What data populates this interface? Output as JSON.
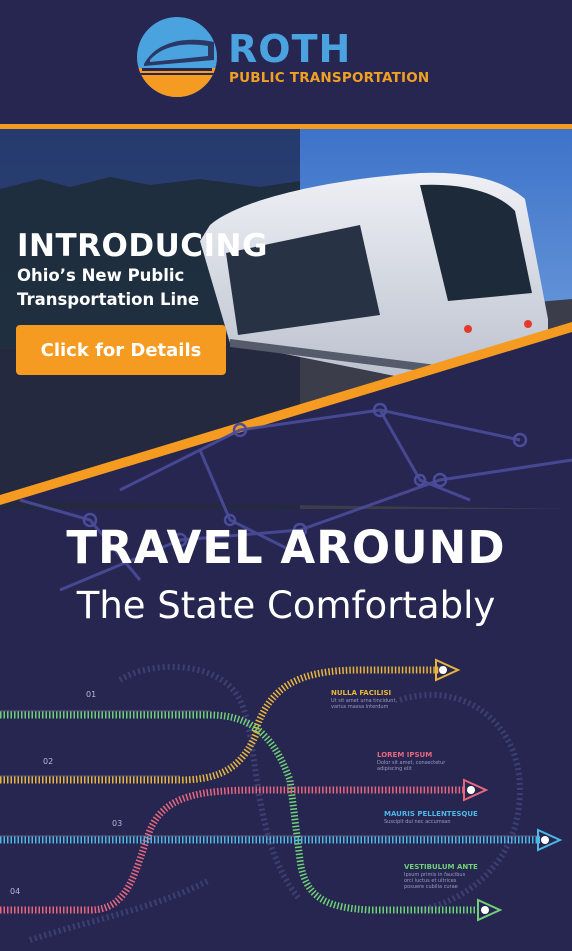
{
  "brand": {
    "name": "ROTH",
    "tagline": "PUBLIC TRANSPORTATION"
  },
  "hero": {
    "title": "INTRODUCING",
    "subtitle": "Ohio’s New Public Transportation Line",
    "cta_label": "Click for Details"
  },
  "promo": {
    "headline": "TRAVEL AROUND",
    "subheadline": "The State Comfortably"
  },
  "routes": [
    {
      "number": "01",
      "title": "NULLA FACILISI",
      "body": "Ut sit amet urna tincidunt, varius massa interdum"
    },
    {
      "number": "02",
      "title": "LOREM IPSUM",
      "body": "Dolor sit amet, consectetur adipiscing elit"
    },
    {
      "number": "03",
      "title": "MAURIS PELLENTESQUE",
      "body": "Suscipit dui nec accumsan"
    },
    {
      "number": "04",
      "title": "VESTIBULUM ANTE",
      "body": "Ipsum primis in faucibus orci luctus et ultrices posuere cubilia curae"
    }
  ],
  "colors": {
    "background": "#262650",
    "accent_orange": "#f59b21",
    "brand_blue": "#4aa3df",
    "route_yellow": "#e8b63c",
    "route_green": "#6fd177",
    "route_pink": "#e8677e",
    "route_blue": "#4fb7e5"
  }
}
